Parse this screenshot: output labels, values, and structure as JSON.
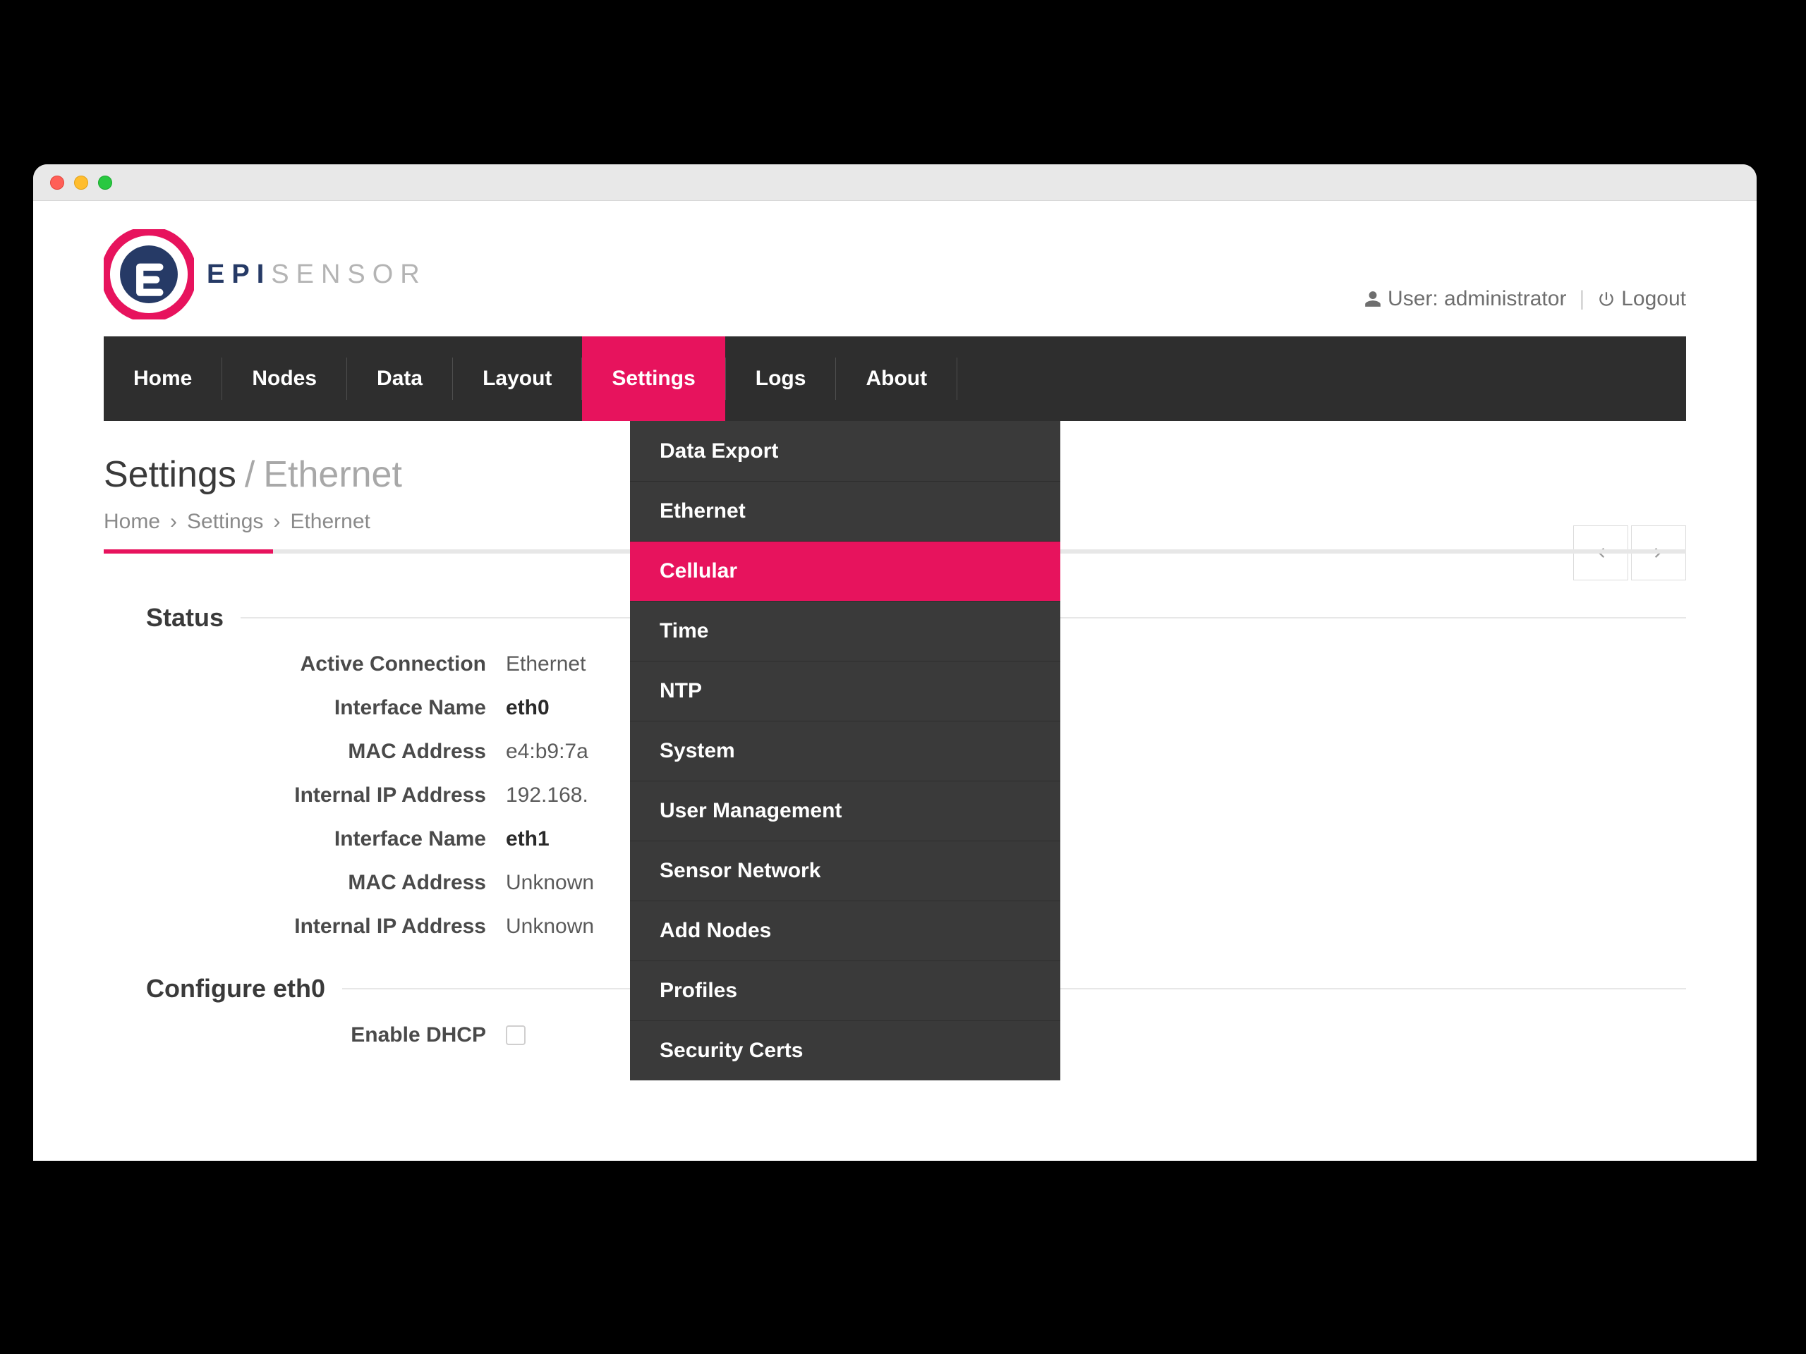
{
  "brand": {
    "epi": "EPI",
    "sensor": "SENSOR"
  },
  "user": {
    "label": "User: administrator",
    "logout": "Logout"
  },
  "nav": {
    "items": [
      {
        "label": "Home"
      },
      {
        "label": "Nodes"
      },
      {
        "label": "Data"
      },
      {
        "label": "Layout"
      },
      {
        "label": "Settings",
        "active": true
      },
      {
        "label": "Logs"
      },
      {
        "label": "About"
      }
    ]
  },
  "dropdown": {
    "items": [
      {
        "label": "Data Export"
      },
      {
        "label": "Ethernet"
      },
      {
        "label": "Cellular",
        "active": true
      },
      {
        "label": "Time"
      },
      {
        "label": "NTP"
      },
      {
        "label": "System"
      },
      {
        "label": "User Management"
      },
      {
        "label": "Sensor Network"
      },
      {
        "label": "Add Nodes"
      },
      {
        "label": "Profiles"
      },
      {
        "label": "Security Certs"
      }
    ]
  },
  "title": {
    "main": "Settings",
    "sep": "/",
    "sub": "Ethernet"
  },
  "breadcrumb": {
    "items": [
      "Home",
      "Settings",
      "Ethernet"
    ],
    "sep": "›"
  },
  "sections": {
    "status": {
      "heading": "Status",
      "rows": [
        {
          "k": "Active Connection",
          "v": "Ethernet",
          "bold": false
        },
        {
          "k": "Interface Name",
          "v": "eth0",
          "bold": true
        },
        {
          "k": "MAC Address",
          "v": "e4:b9:7a",
          "bold": false
        },
        {
          "k": "Internal IP Address",
          "v": "192.168.",
          "bold": false
        },
        {
          "k": "Interface Name",
          "v": "eth1",
          "bold": true
        },
        {
          "k": "MAC Address",
          "v": "Unknown",
          "bold": false
        },
        {
          "k": "Internal IP Address",
          "v": "Unknown",
          "bold": false
        }
      ]
    },
    "configure": {
      "heading": "Configure eth0",
      "rows": [
        {
          "k": "Enable DHCP",
          "checkbox": true
        }
      ]
    }
  },
  "colors": {
    "accent": "#e7135d",
    "navbg": "#2e2e2e"
  }
}
